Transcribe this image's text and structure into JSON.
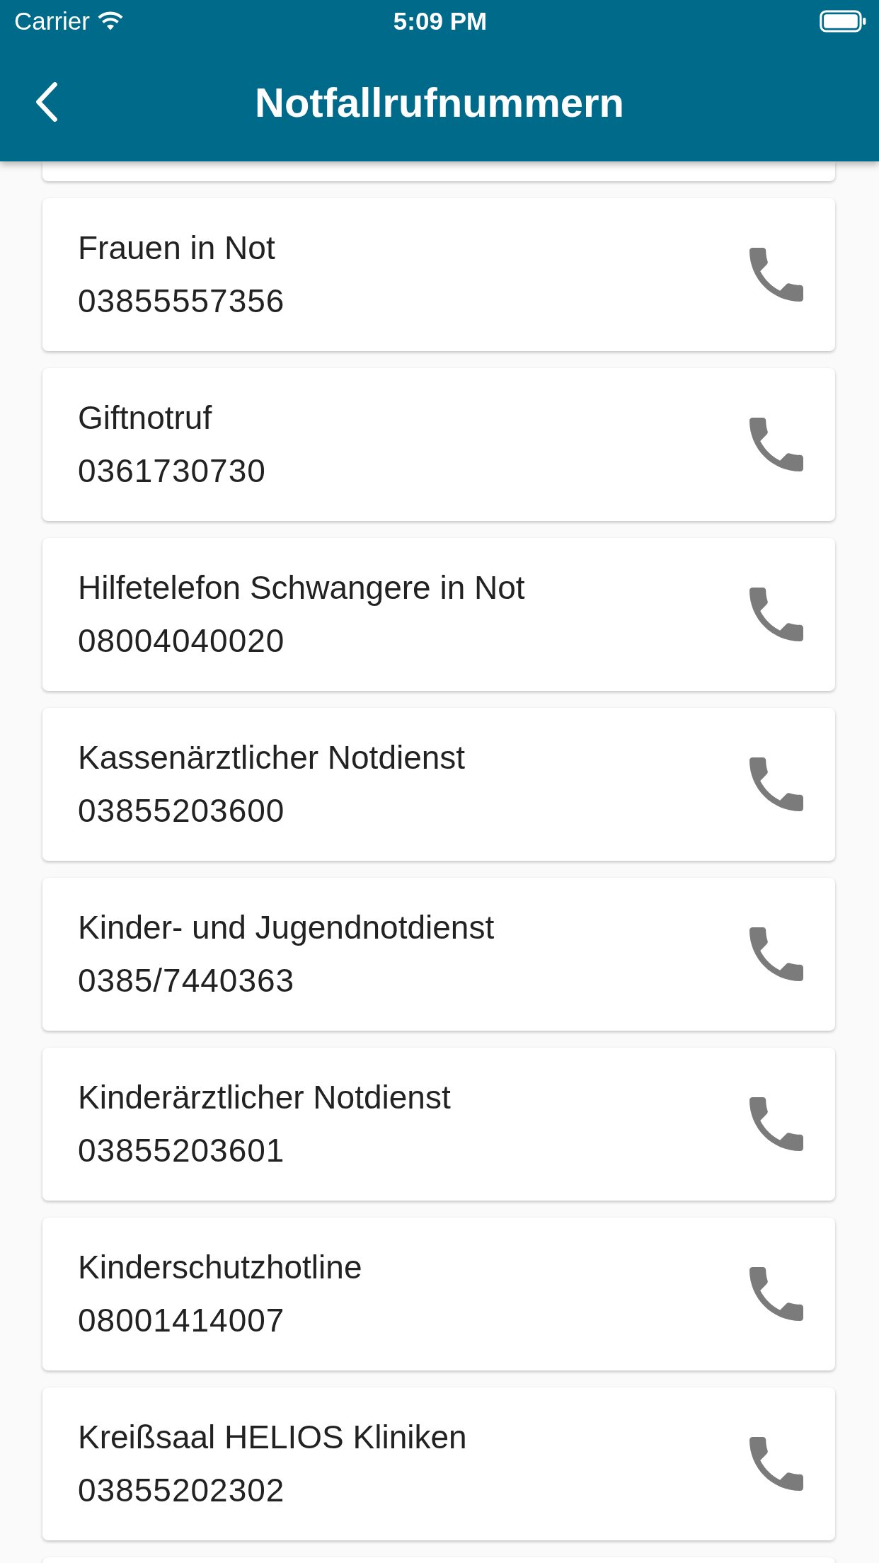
{
  "status_bar": {
    "carrier": "Carrier",
    "time": "5:09 PM"
  },
  "app_bar": {
    "title": "Notfallrufnummern"
  },
  "contacts": [
    {
      "name": "Frauen in Not",
      "number": "03855557356"
    },
    {
      "name": "Giftnotruf",
      "number": "0361730730"
    },
    {
      "name": "Hilfetelefon Schwangere in Not",
      "number": "08004040020"
    },
    {
      "name": "Kassenärztlicher Notdienst",
      "number": "03855203600"
    },
    {
      "name": "Kinder- und Jugendnotdienst",
      "number": "0385/7440363"
    },
    {
      "name": "Kinderärztlicher Notdienst",
      "number": "03855203601"
    },
    {
      "name": "Kinderschutzhotline",
      "number": "08001414007"
    },
    {
      "name": "Kreißsaal HELIOS Kliniken",
      "number": "03855202302"
    }
  ]
}
